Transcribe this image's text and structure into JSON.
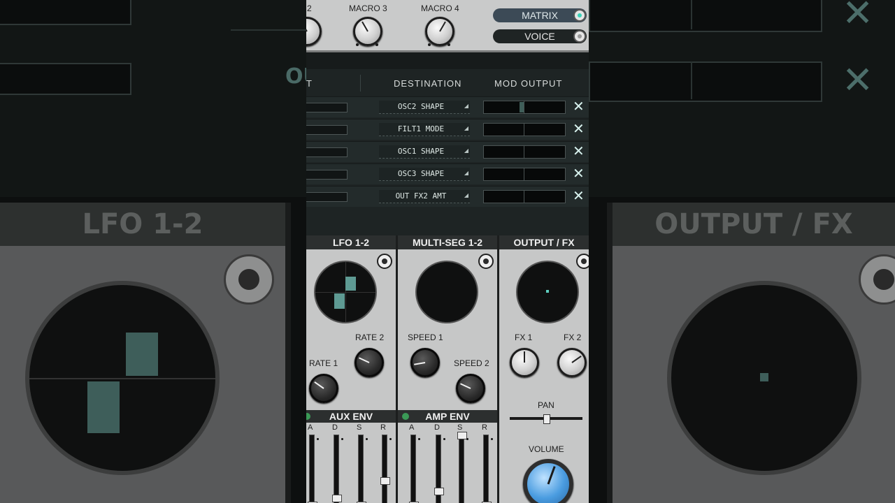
{
  "background": {
    "lfo_title": "LFO 1-2",
    "output_title": "OUTPUT / FX",
    "partial_label": "OU",
    "x_glyph": "✕"
  },
  "macros": {
    "items": [
      {
        "label": "2",
        "angle": 150
      },
      {
        "label": "MACRO 3",
        "angle": 150
      },
      {
        "label": "MACRO 4",
        "angle": 210
      }
    ],
    "view_buttons": [
      {
        "label": "MATRIX",
        "active": true
      },
      {
        "label": "VOICE",
        "active": false
      }
    ]
  },
  "matrix": {
    "headers": {
      "source": "T",
      "destination": "DESTINATION",
      "mod_output": "MOD OUTPUT"
    },
    "remove_glyph": "✕",
    "dropdown_glyph": "◢",
    "rows": [
      {
        "destination": "OSC2 SHAPE",
        "output": -0.05
      },
      {
        "destination": "FILT1 MODE",
        "output": 0
      },
      {
        "destination": "OSC1 SHAPE",
        "output": 0
      },
      {
        "destination": "OSC3 SHAPE",
        "output": 0
      },
      {
        "destination": "OUT FX2 AMT",
        "output": 0
      }
    ]
  },
  "sections": {
    "lfo": {
      "title": "LFO 1-2",
      "rate1_label": "RATE 1",
      "rate2_label": "RATE 2",
      "rate1_angle": 125,
      "rate2_angle": 115
    },
    "multiseg": {
      "title": "MULTI-SEG 1-2",
      "speed1_label": "SPEED 1",
      "speed2_label": "SPEED 2",
      "speed1_angle": 80,
      "speed2_angle": 115
    },
    "output": {
      "title": "OUTPUT / FX",
      "fx1_label": "FX 1",
      "fx2_label": "FX 2",
      "pan_label": "PAN",
      "volume_label": "VOLUME",
      "fx1_angle": 180,
      "fx2_angle": 235,
      "volume_angle": 200,
      "pan_value": 0.5
    },
    "aux_env": {
      "title": "AUX ENV",
      "labels": [
        "A",
        "D",
        "S",
        "R"
      ],
      "levels": [
        0.0,
        0.1,
        0.0,
        0.35
      ]
    },
    "amp_env": {
      "title": "AMP ENV",
      "labels": [
        "A",
        "D",
        "S",
        "R"
      ],
      "levels": [
        0.0,
        0.2,
        1.0,
        0.0
      ]
    }
  },
  "colors": {
    "accent": "#3bd2b8",
    "lfo_bar": "#5e9a93",
    "mod_fill": "#3f5e59"
  }
}
